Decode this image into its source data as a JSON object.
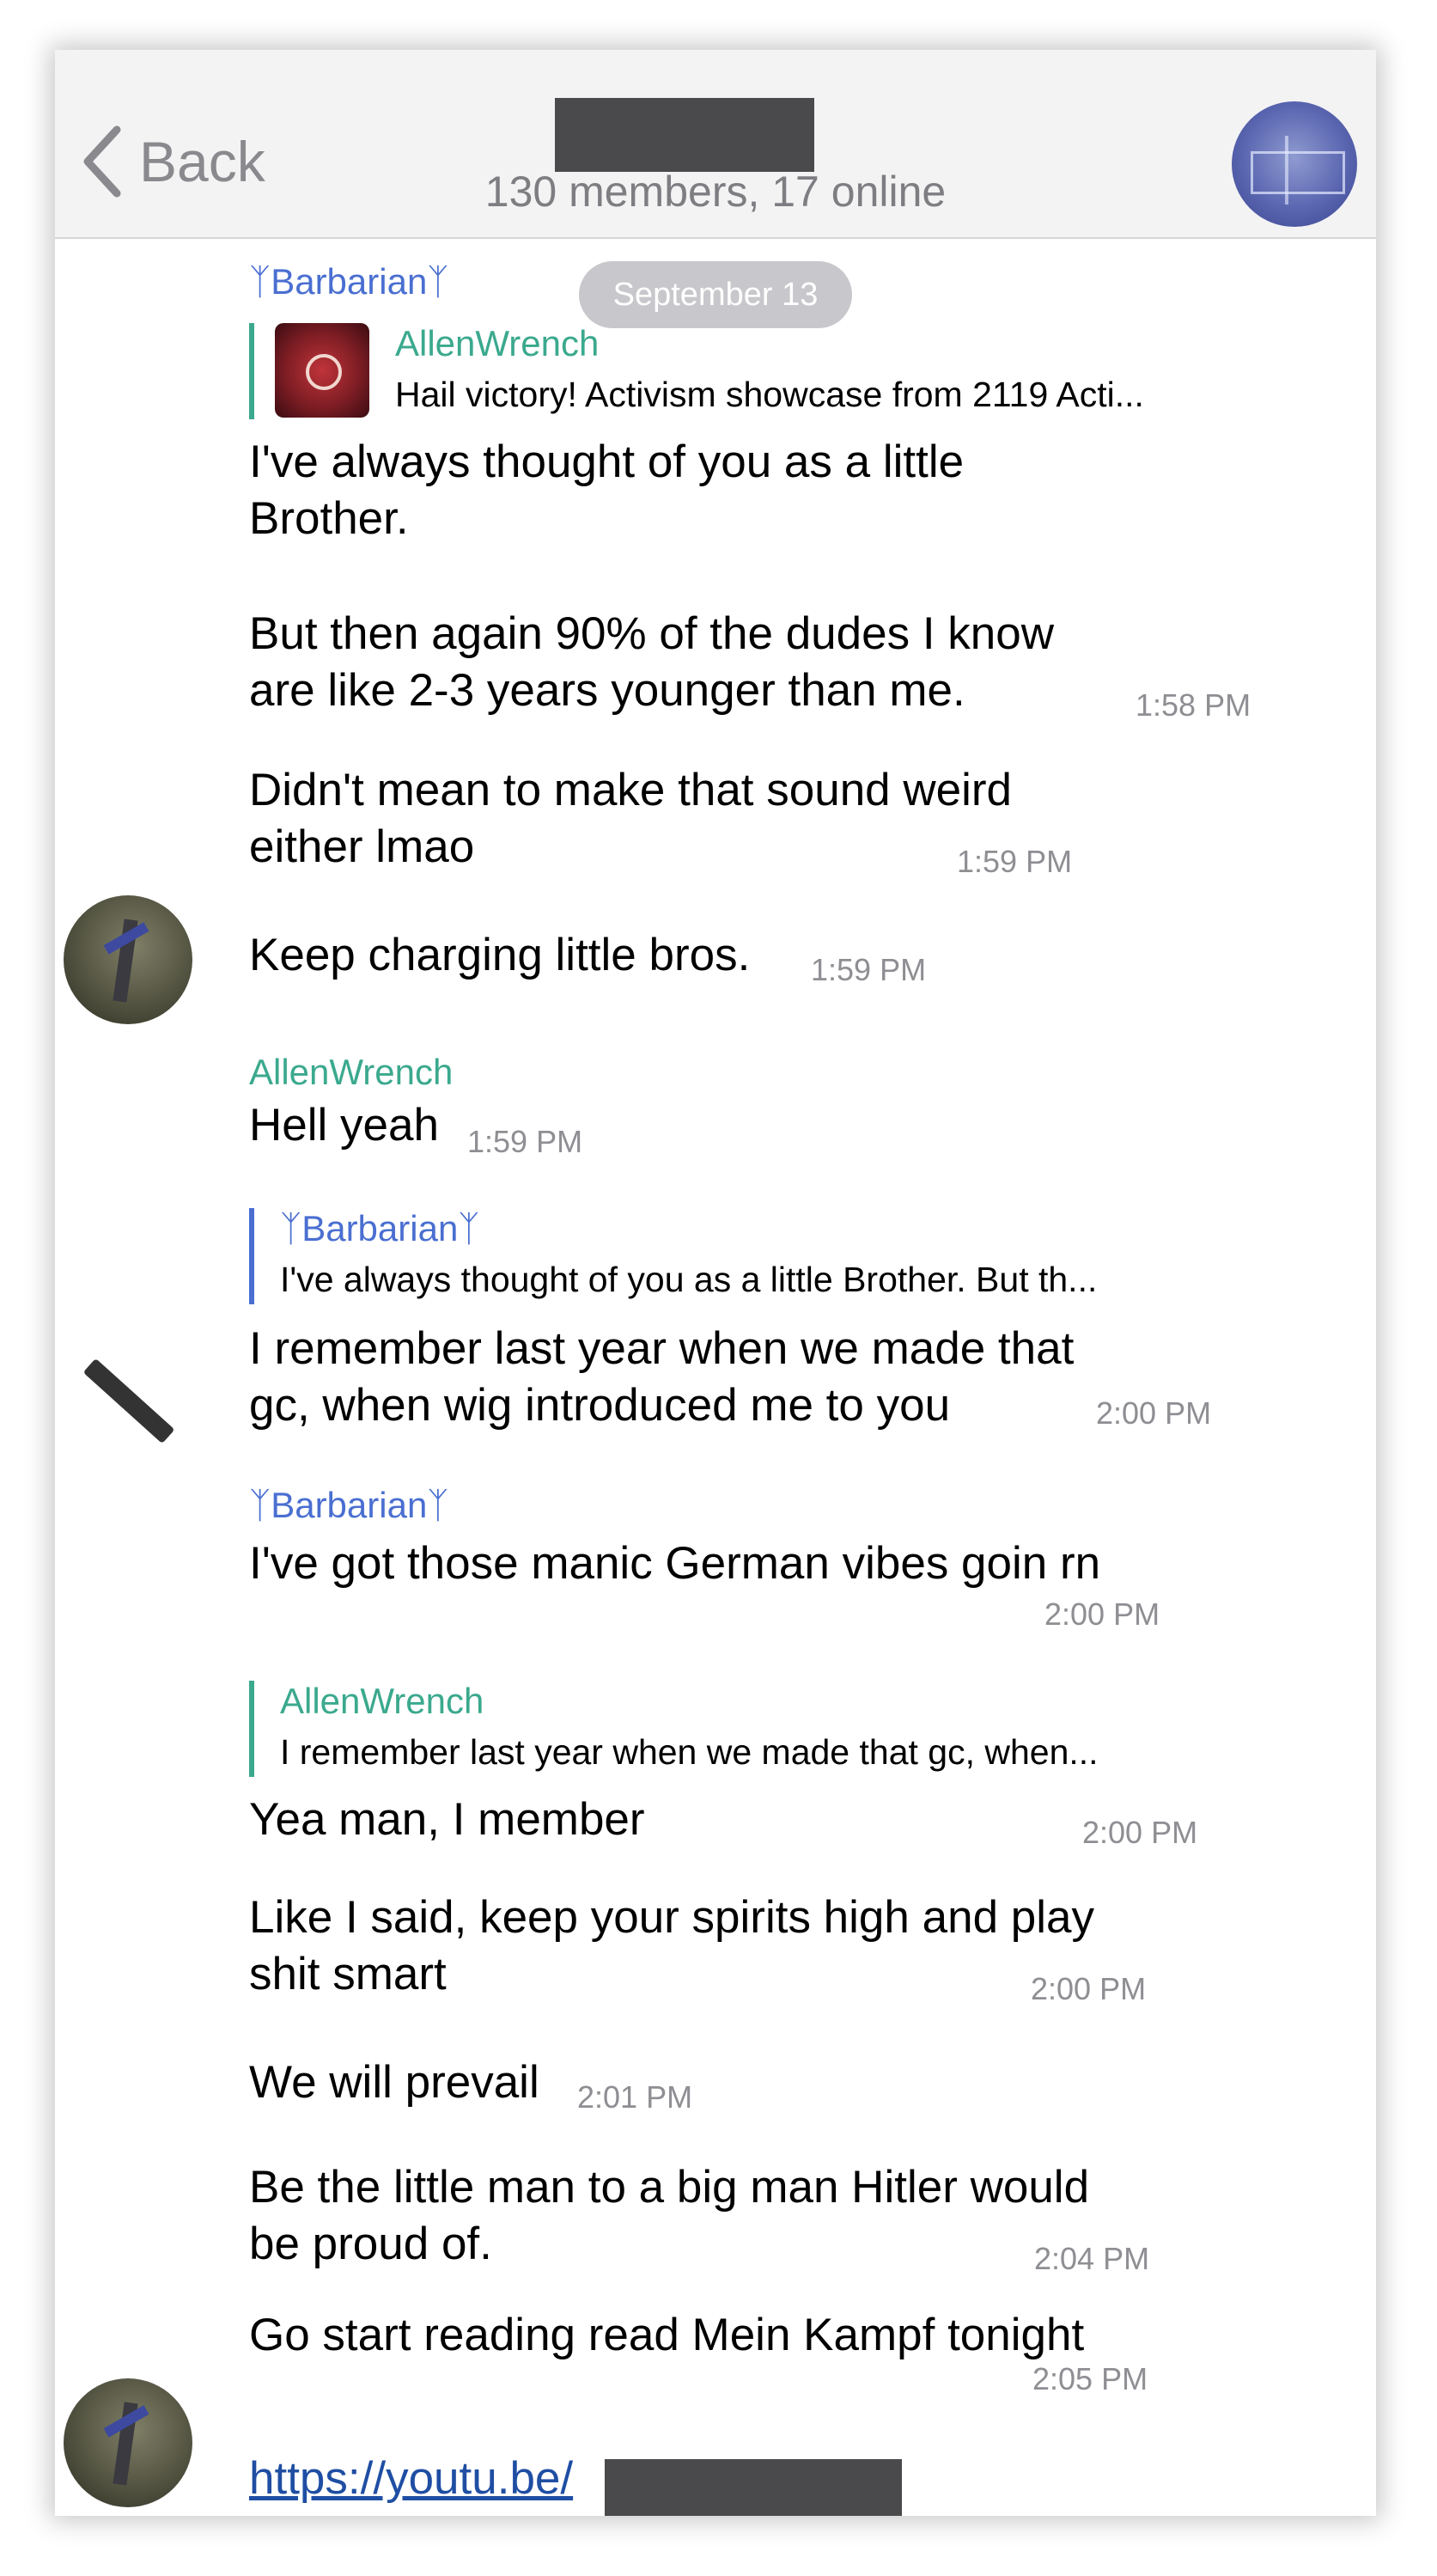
{
  "header": {
    "back_label": "Back",
    "subtitle": "130 members, 17 online"
  },
  "date_pill": "September 13",
  "messages": [
    {
      "sender": "ᛉBarbarianᛉ",
      "reply_name": "AllenWrench",
      "reply_text": "Hail victory! Activism showcase from 2119 Acti...",
      "line1": "I've always thought of you as a little",
      "line2": "Brother.",
      "line3": "But then again 90% of the dudes I know",
      "line4": "are like 2-3 years younger than me.",
      "time": "1:58 PM"
    },
    {
      "line1": "Didn't mean to make that sound weird",
      "line2": "either lmao",
      "time": "1:59 PM"
    },
    {
      "line1": "Keep charging little bros.",
      "time": "1:59 PM"
    },
    {
      "sender": "AllenWrench",
      "line1": "Hell yeah",
      "time": "1:59 PM"
    },
    {
      "reply_name": "ᛉBarbarianᛉ",
      "reply_text": "I've always thought of you as a little Brother. But th...",
      "line1": "I remember last year when we made that",
      "line2": "gc, when wig introduced me to you",
      "time": "2:00 PM"
    },
    {
      "sender": "ᛉBarbarianᛉ",
      "line1": "I've got those manic German vibes goin rn",
      "time": "2:00 PM"
    },
    {
      "reply_name": "AllenWrench",
      "reply_text": "I remember last year when we made that gc, when...",
      "line1": "Yea man, I member",
      "time": "2:00 PM"
    },
    {
      "line1": "Like I said, keep your spirits high and play",
      "line2": "shit smart",
      "time": "2:00 PM"
    },
    {
      "line1": "We will prevail",
      "time": "2:01 PM"
    },
    {
      "line1": "Be the little man to a big man Hitler would",
      "line2": "be proud of.",
      "time": "2:04 PM"
    },
    {
      "line1": "Go start reading read Mein Kampf tonight",
      "time": "2:05 PM"
    },
    {
      "link": "https://youtu.be/"
    }
  ],
  "colors": {
    "blue_name": "#4a6fd1",
    "green_name": "#3ba98e",
    "link": "#1f4ea3",
    "redaction": "#4a4a4c"
  }
}
